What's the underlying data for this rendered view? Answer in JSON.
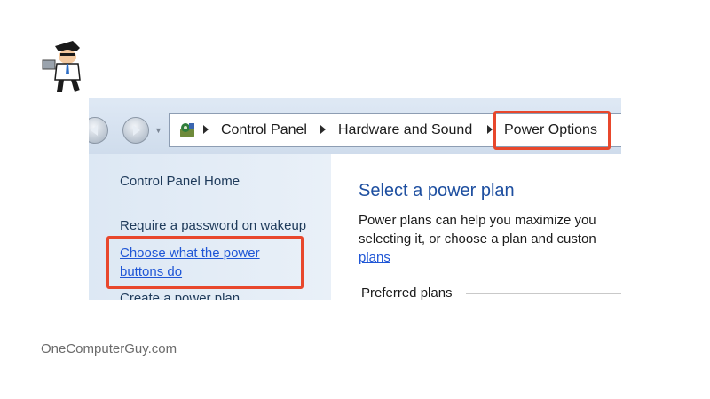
{
  "breadcrumb": {
    "items": [
      "Control Panel",
      "Hardware and Sound",
      "Power Options"
    ]
  },
  "left_pane": {
    "home": "Control Panel Home",
    "require_password": "Require a password on wakeup",
    "choose_buttons_line1": "Choose what the power",
    "choose_buttons_line2": "buttons do",
    "create_plan": "Create a power plan"
  },
  "main": {
    "title": "Select a power plan",
    "desc_line1": "Power plans can help you maximize you",
    "desc_line2": "selecting it, or choose a plan and custon",
    "desc_link": "plans",
    "preferred_plans": "Preferred plans"
  },
  "watermark": "OneComputerGuy.com",
  "colors": {
    "highlight": "#e8472c",
    "link": "#1f56d6",
    "title": "#1e4fa0"
  }
}
